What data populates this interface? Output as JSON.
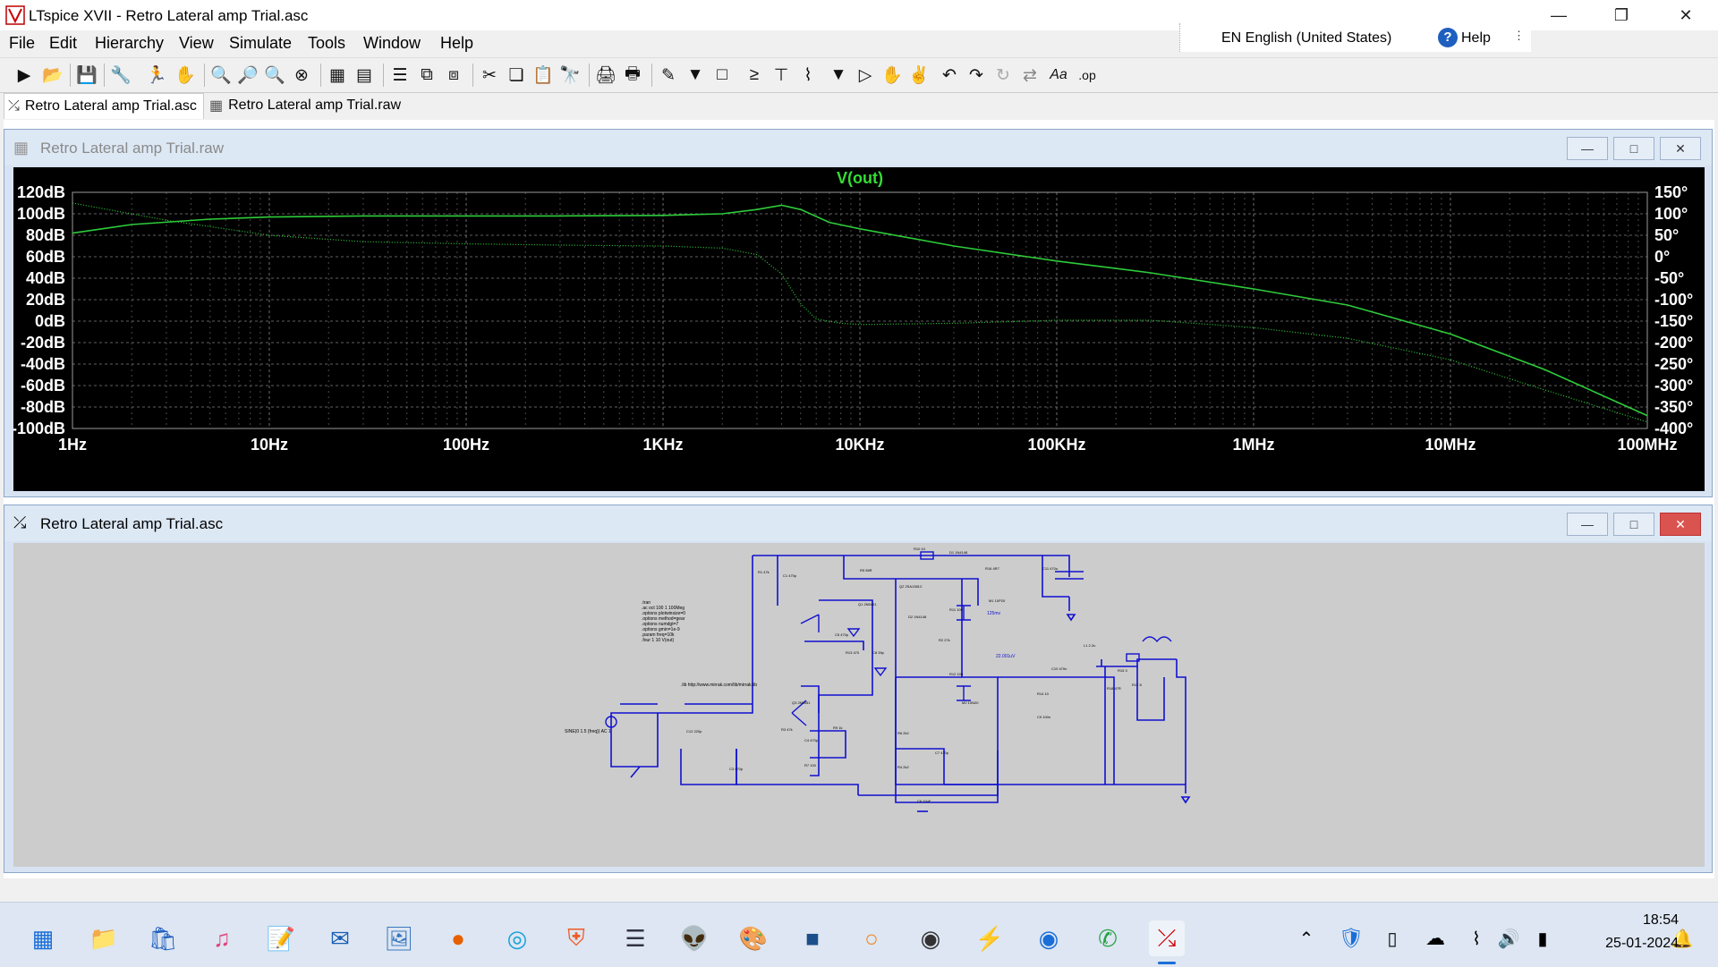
{
  "window": {
    "title": "LTspice XVII - Retro Lateral amp Trial.asc"
  },
  "language": {
    "label": "EN English (United States)",
    "help": "Help"
  },
  "menu": [
    "File",
    "Edit",
    "Hierarchy",
    "View",
    "Simulate",
    "Tools",
    "Window",
    "Help"
  ],
  "tabs": [
    {
      "label": "Retro Lateral amp Trial.asc",
      "icon": "schematic-icon"
    },
    {
      "label": "Retro Lateral amp Trial.raw",
      "icon": "waveform-icon"
    }
  ],
  "plot_window": {
    "title": "Retro Lateral amp Trial.raw"
  },
  "schematic_window": {
    "title": "Retro Lateral amp Trial.asc"
  },
  "chart_data": {
    "type": "line",
    "title": "V(out)",
    "x_scale": "log",
    "xlim": [
      1,
      100000000
    ],
    "x_ticks": [
      "1Hz",
      "10Hz",
      "100Hz",
      "1KHz",
      "10KHz",
      "100KHz",
      "1MHz",
      "10MHz",
      "100MHz"
    ],
    "y_left_ticks": [
      "120dB",
      "100dB",
      "80dB",
      "60dB",
      "40dB",
      "20dB",
      "0dB",
      "-20dB",
      "-40dB",
      "-60dB",
      "-80dB",
      "-100dB"
    ],
    "y_right_ticks": [
      "150°",
      "100°",
      "50°",
      "0°",
      "-50°",
      "-100°",
      "-150°",
      "-200°",
      "-250°",
      "-300°",
      "-350°",
      "-400°"
    ],
    "ylim_left": [
      -100,
      120
    ],
    "ylim_right": [
      -400,
      150
    ],
    "grid": true,
    "colors": {
      "trace": "#2ecc3a",
      "background": "#000000",
      "text": "#ffffff",
      "title": "#33dd33"
    },
    "series": [
      {
        "axis": "left",
        "style": "solid",
        "x": [
          1,
          2,
          5,
          10,
          30,
          100,
          300,
          1000,
          2000,
          3000,
          4000,
          5000,
          7000,
          10000,
          30000,
          100000,
          300000,
          1000000,
          3000000,
          10000000,
          30000000,
          100000000
        ],
        "y": [
          82,
          90,
          95,
          97,
          98,
          98,
          98,
          98.5,
          100,
          104,
          108,
          104,
          92,
          86,
          70,
          56,
          45,
          30,
          15,
          -12,
          -45,
          -88
        ]
      },
      {
        "axis": "right",
        "style": "dotted",
        "x": [
          1,
          3,
          10,
          30,
          100,
          300,
          1000,
          2000,
          3000,
          4000,
          5000,
          6000,
          8000,
          10000,
          30000,
          100000,
          300000,
          1000000,
          3000000,
          10000000,
          30000000,
          100000000
        ],
        "y": [
          125,
          85,
          50,
          35,
          30,
          27,
          25,
          20,
          5,
          -40,
          -110,
          -145,
          -155,
          -158,
          -155,
          -148,
          -148,
          -165,
          -190,
          -240,
          -310,
          -385
        ]
      }
    ]
  },
  "schematic": {
    "spice_directives": [
      ".tran",
      ".ac oct 100 1 100Meg",
      ".options plotwinsize=0",
      ".options method=gear",
      ".options numdgt=7",
      ".options gmin=1e-9",
      ".param freq=10k",
      ".four 1 10 V(out)"
    ],
    "include": ".lib http://www.mirrak.com/lib/mirrak.lib",
    "source_label": "SINE(0 1.5 {freq}) AC 1",
    "components": [
      "R1 47k",
      "C1 470p",
      "R5 56R",
      "Q1 2N5401",
      "Q2 2SA1381C",
      "R10 10",
      "D1 1N4148",
      "R16 4R7",
      "C11 470u",
      "M1 10P20",
      "R11 100",
      "D2 1N4148",
      "R2 27k",
      "C5 470p",
      "R13 470",
      "C8 39p",
      "C10 470n",
      "L1 2.2u",
      "R15 3",
      "R14 10",
      "C9 100n",
      "R18 47R",
      "R17 8",
      "Q3 2N5551",
      "R3 47k",
      "C4 470p",
      "R7 100",
      "R6 2k2",
      "C7 470p",
      "R4 2k2",
      "C3 470p",
      "R9 1k",
      "C12 220p",
      "R12 100",
      "M2 10N20",
      "C6 10uF"
    ],
    "net_labels": [
      "22.001uV",
      "125mv"
    ]
  },
  "taskbar": {
    "apps": [
      "windows-start-icon",
      "file-explorer-icon",
      "store-icon",
      "itunes-icon",
      "notepad-icon",
      "mail-icon",
      "photos-icon",
      "firefox-icon",
      "edge-icon",
      "brave-icon",
      "ltwiki-icon",
      "alien-icon",
      "paint-icon",
      "python-icon",
      "sublime-icon",
      "steam-icon",
      "winamp-icon",
      "vpn-icon",
      "whatsapp-icon",
      "ltspice-icon"
    ],
    "tray": [
      "chevron-up-icon",
      "security-icon",
      "usb-icon",
      "onedrive-icon",
      "wifi-icon",
      "volume-icon",
      "battery-icon"
    ],
    "time": "18:54",
    "date": "25-01-2024"
  }
}
